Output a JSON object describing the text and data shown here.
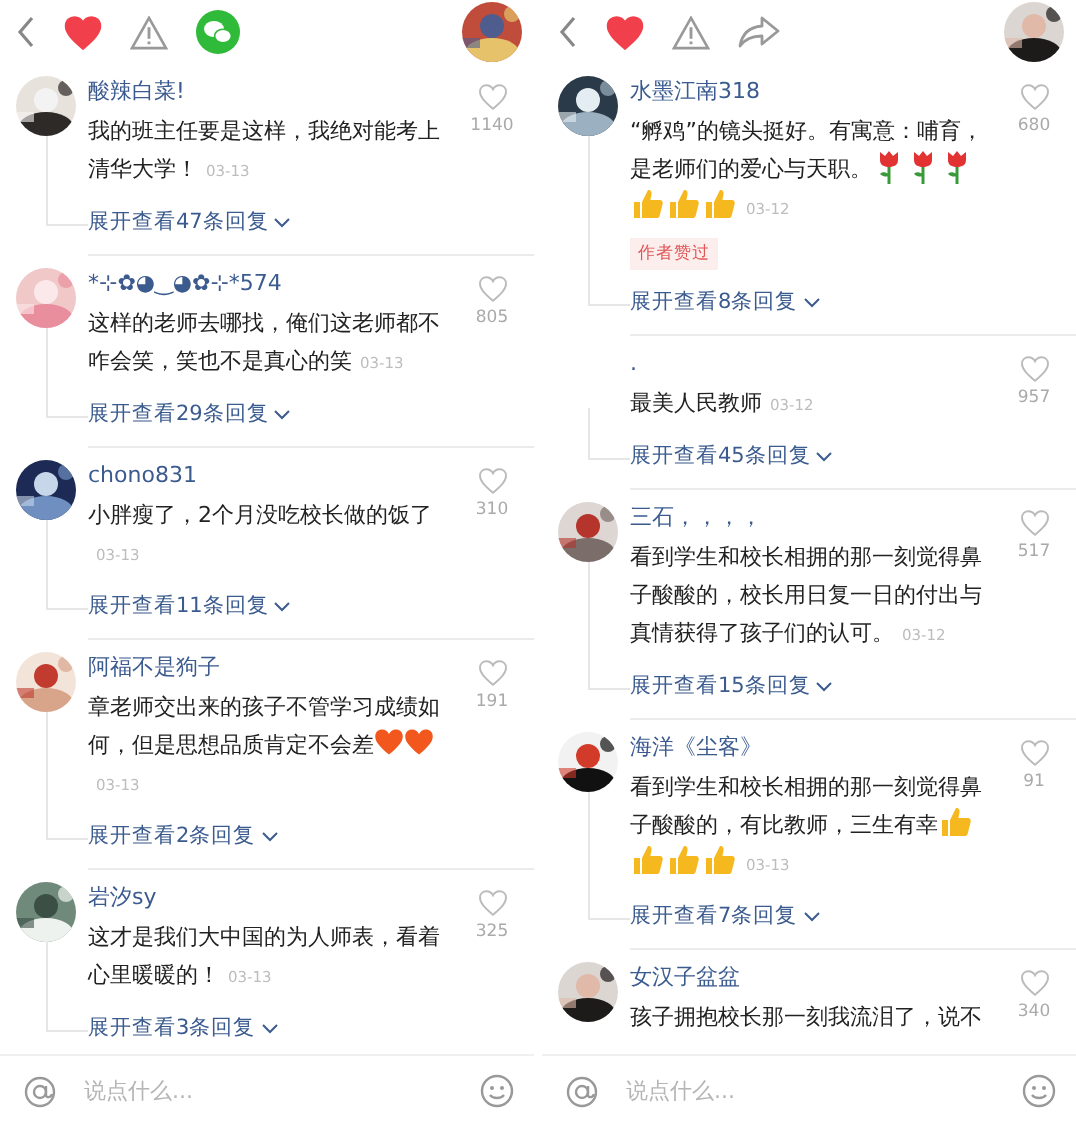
{
  "panes": [
    {
      "header": {
        "actions": [
          {
            "kind": "back"
          },
          {
            "kind": "like",
            "liked": true
          },
          {
            "kind": "report"
          },
          {
            "kind": "wechat"
          }
        ],
        "avatar": {
          "kind": "picture"
        }
      },
      "comments": [
        {
          "avatar": {
            "kind": "picture"
          },
          "name": "酸辣白菜!",
          "parts": [
            {
              "kind": "text",
              "text": "我的班主任要是这样，我绝对能考上清华大学！"
            }
          ],
          "date": "03-13",
          "likes": "1140",
          "replies": "展开查看47条回复"
        },
        {
          "avatar": {
            "kind": "picture"
          },
          "name": "*⊹✿◕‿◕✿⊹*574",
          "parts": [
            {
              "kind": "text",
              "text": "这样的老师去哪找，俺们这老师都不咋会笑，笑也不是真心的笑"
            }
          ],
          "date": "03-13",
          "likes": "805",
          "replies": "展开查看29条回复"
        },
        {
          "avatar": {
            "kind": "picture"
          },
          "name": "chono831",
          "parts": [
            {
              "kind": "text",
              "text": "小胖瘦了，2个月没吃校长做的饭了"
            }
          ],
          "date": "03-13",
          "likes": "310",
          "replies": "展开查看11条回复"
        },
        {
          "avatar": {
            "kind": "picture"
          },
          "name": "阿福不是狗子",
          "parts": [
            {
              "kind": "text",
              "text": "章老师交出来的孩子不管学习成绩如何，但是思想品质肯定不会差"
            },
            {
              "kind": "heart"
            },
            {
              "kind": "heart"
            }
          ],
          "date": "03-13",
          "likes": "191",
          "replies": "展开查看2条回复"
        },
        {
          "avatar": {
            "kind": "picture"
          },
          "name": "岩汐sy",
          "parts": [
            {
              "kind": "text",
              "text": "这才是我们大中国的为人师表，看着心里暖暖的！"
            }
          ],
          "date": "03-13",
          "likes": "325",
          "replies": "展开查看3条回复"
        }
      ],
      "input": {
        "placeholder": "说点什么..."
      }
    },
    {
      "header": {
        "actions": [
          {
            "kind": "back"
          },
          {
            "kind": "like",
            "liked": true
          },
          {
            "kind": "report"
          },
          {
            "kind": "share"
          }
        ],
        "avatar": {
          "kind": "picture"
        }
      },
      "comments": [
        {
          "avatar": {
            "kind": "picture"
          },
          "name": "水墨江南318",
          "parts": [
            {
              "kind": "text",
              "text": "“孵鸡”的镜头挺好。有寓意：哺育，是老师们的爱心与天职。"
            },
            {
              "kind": "rose"
            },
            {
              "kind": "rose"
            },
            {
              "kind": "rose"
            },
            {
              "kind": "thumb"
            },
            {
              "kind": "thumb"
            },
            {
              "kind": "thumb"
            }
          ],
          "date": "03-12",
          "likes": "680",
          "badge": "作者赞过",
          "replies": "展开查看8条回复"
        },
        {
          "avatar": {
            "kind": "blank"
          },
          "name": ".",
          "parts": [
            {
              "kind": "text",
              "text": "最美人民教师"
            }
          ],
          "date": "03-12",
          "likes": "957",
          "replies": "展开查看45条回复"
        },
        {
          "avatar": {
            "kind": "picture"
          },
          "name": "三石，，，，",
          "parts": [
            {
              "kind": "text",
              "text": "看到学生和校长相拥的那一刻觉得鼻子酸酸的，校长用日复一日的付出与真情获得了孩子们的认可。"
            }
          ],
          "date": "03-12",
          "likes": "517",
          "replies": "展开查看15条回复"
        },
        {
          "avatar": {
            "kind": "picture"
          },
          "name": "海洋《尘客》",
          "parts": [
            {
              "kind": "text",
              "text": "看到学生和校长相拥的那一刻觉得鼻子酸酸的，有比教师，三生有幸"
            },
            {
              "kind": "thumb"
            },
            {
              "kind": "thumb"
            },
            {
              "kind": "thumb"
            },
            {
              "kind": "thumb"
            }
          ],
          "date": "03-13",
          "likes": "91",
          "replies": "展开查看7条回复"
        },
        {
          "avatar": {
            "kind": "picture"
          },
          "name": "女汉子盆盆",
          "parts": [
            {
              "kind": "text",
              "text": "孩子拥抱校长那一刻我流泪了，说不"
            }
          ],
          "likes": "340"
        }
      ],
      "input": {
        "placeholder": "说点什么..."
      }
    }
  ]
}
